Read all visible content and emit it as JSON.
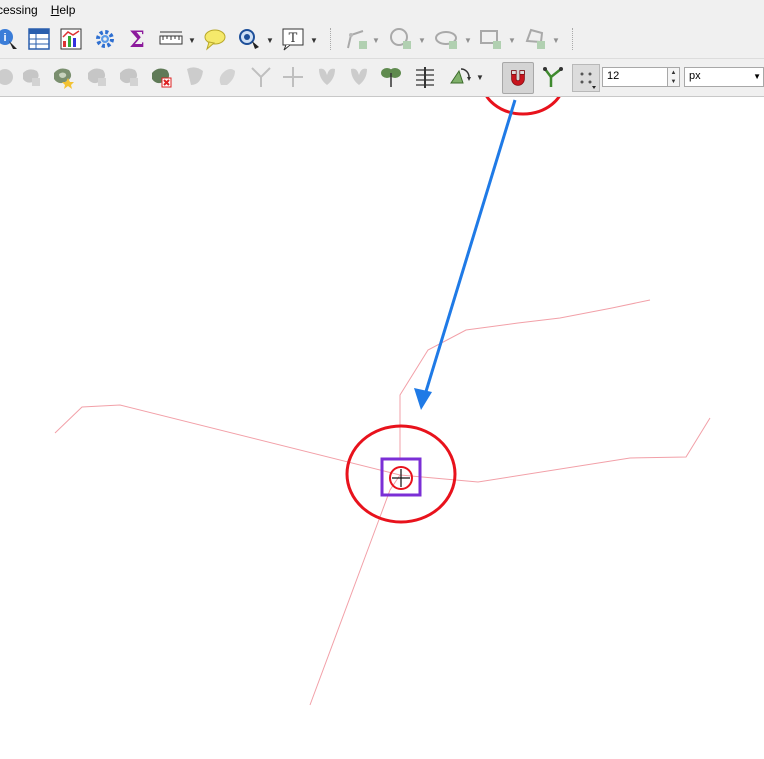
{
  "menubar": {
    "items": [
      {
        "label": "cessing"
      },
      {
        "label": "Help"
      }
    ]
  },
  "toolbar_top": {
    "icons": [
      "identify-icon",
      "attribute-table-icon",
      "statistics-icon",
      "gear-icon",
      "sum-icon",
      "measure-icon",
      "map-tip-icon",
      "zoom-select-icon",
      "text-annotation-icon",
      "add-line-icon",
      "add-circle-icon",
      "add-ellipse-icon",
      "add-rectangle-icon",
      "add-polygon-icon"
    ]
  },
  "toolbar_digitize": {
    "icons": [
      "add-ring-icon",
      "add-part-icon",
      "fill-ring-icon",
      "delete-ring-icon",
      "delete-part-icon",
      "reshape-icon",
      "offset-curve-icon",
      "split-features-icon",
      "split-parts-icon",
      "merge-features-icon",
      "merge-attributes-icon",
      "rotate-point-symbols-icon",
      "vertex-tool-icon",
      "rotate-feature-icon"
    ],
    "snapping_icon": "magnet-icon",
    "tracing_icon": "tracing-icon",
    "snapping_mode_icon": "snapping-mode-icon",
    "tolerance_value": "12",
    "tolerance_unit": "px"
  },
  "colors": {
    "annotation_red": "#e8121c",
    "arrow_blue": "#1f7ae6",
    "cursor_box": "#7b2fd6",
    "feature_line": "#f2a0a8",
    "toolbar_bg": "#f0f0f0"
  }
}
